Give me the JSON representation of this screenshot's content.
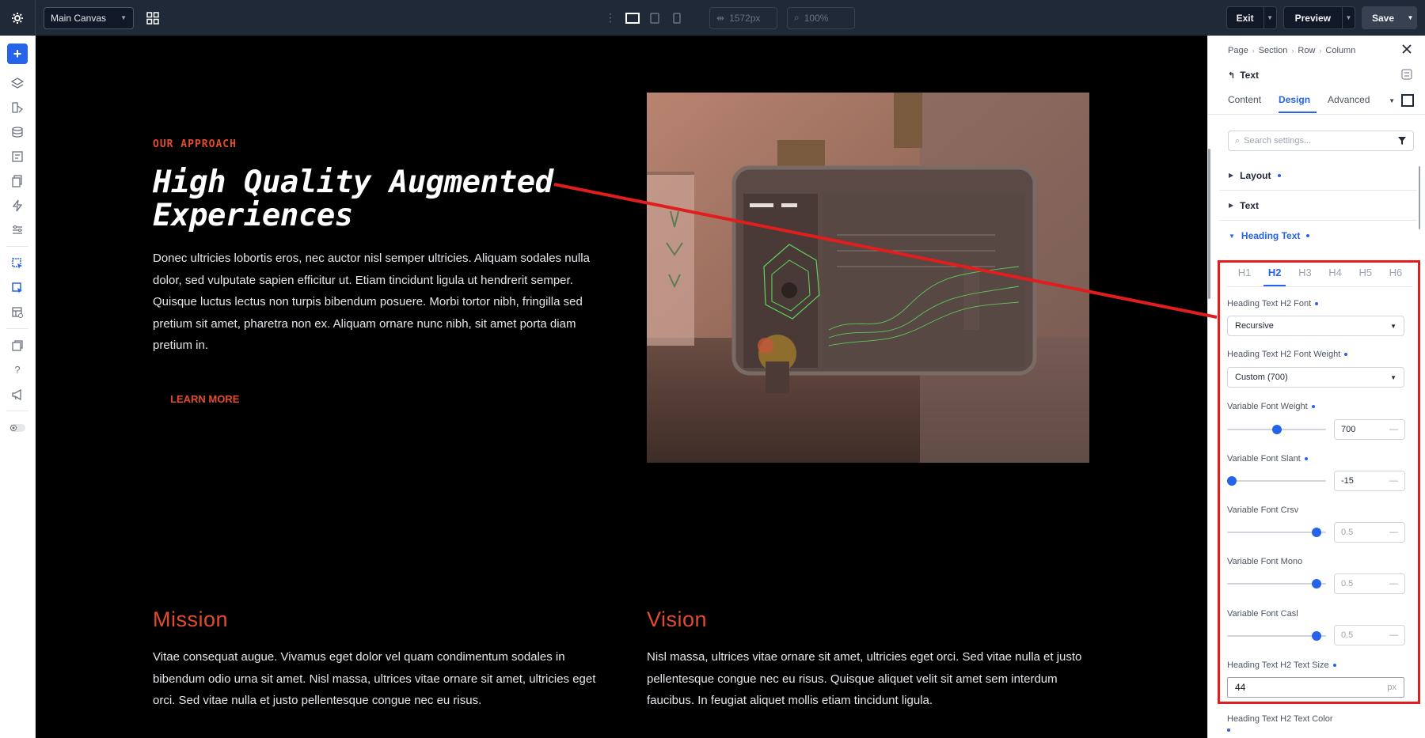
{
  "topbar": {
    "canvas_select": "Main Canvas",
    "width_value": "1572px",
    "zoom_value": "100%",
    "exit_label": "Exit",
    "preview_label": "Preview",
    "save_label": "Save"
  },
  "canvas": {
    "eyebrow": "OUR APPROACH",
    "headline_line1": "High Quality Augmented",
    "headline_line2": "Experiences",
    "paragraph": "Donec ultricies lobortis eros, nec auctor nisl semper ultricies. Aliquam sodales nulla dolor, sed vulputate sapien efficitur ut. Etiam tincidunt ligula ut hendrerit semper. Quisque luctus lectus non turpis bibendum posuere. Morbi tortor nibh, fringilla sed pretium sit amet, pharetra non ex. Aliquam ornare nunc nibh, sit amet porta diam pretium in.",
    "learn_more": "LEARN MORE",
    "mission_heading": "Mission",
    "mission_text": "Vitae consequat augue. Vivamus eget dolor vel quam condimentum sodales in bibendum odio urna sit amet. Nisl massa, ultrices vitae ornare sit amet, ultricies eget orci. Sed vitae nulla et justo pellentesque congue nec eu risus.",
    "vision_heading": "Vision",
    "vision_text": "Nisl massa, ultrices vitae ornare sit amet, ultricies eget orci. Sed vitae nulla et justo pellentesque congue nec eu risus. Quisque aliquet velit sit amet sem interdum faucibus. In feugiat aliquet mollis etiam tincidunt ligula."
  },
  "panel": {
    "breadcrumb": [
      "Page",
      "Section",
      "Row",
      "Column"
    ],
    "element_title": "Text",
    "tabs": [
      "Content",
      "Design",
      "Advanced"
    ],
    "active_tab": "Design",
    "search_placeholder": "Search settings...",
    "sections": {
      "layout": "Layout",
      "text": "Text",
      "heading_text": "Heading Text"
    },
    "heading_tabs": [
      "H1",
      "H2",
      "H3",
      "H4",
      "H5",
      "H6"
    ],
    "active_heading": "H2",
    "font_label": "Heading Text H2 Font",
    "font_value": "Recursive",
    "weight_label": "Heading Text H2 Font Weight",
    "weight_value": "Custom (700)",
    "var_weight_label": "Variable Font Weight",
    "var_weight_value": "700",
    "var_weight_level": 0.5,
    "var_slant_label": "Variable Font Slant",
    "var_slant_value": "-15",
    "var_slant_level": 0.0,
    "var_crsv_label": "Variable Font Crsv",
    "var_crsv_value": "0.5",
    "var_crsv_level": 0.95,
    "var_mono_label": "Variable Font Mono",
    "var_mono_value": "0.5",
    "var_mono_level": 0.95,
    "var_casl_label": "Variable Font Casl",
    "var_casl_value": "0.5",
    "var_casl_level": 0.95,
    "size_label": "Heading Text H2 Text Size",
    "size_value": "44",
    "size_unit": "px",
    "color_label": "Heading Text H2 Text Color"
  },
  "colors": {
    "accent": "#2563eb",
    "brand_orange": "#e24b2b",
    "highlight_red": "#e11d1d",
    "topbar": "#1f2937"
  }
}
